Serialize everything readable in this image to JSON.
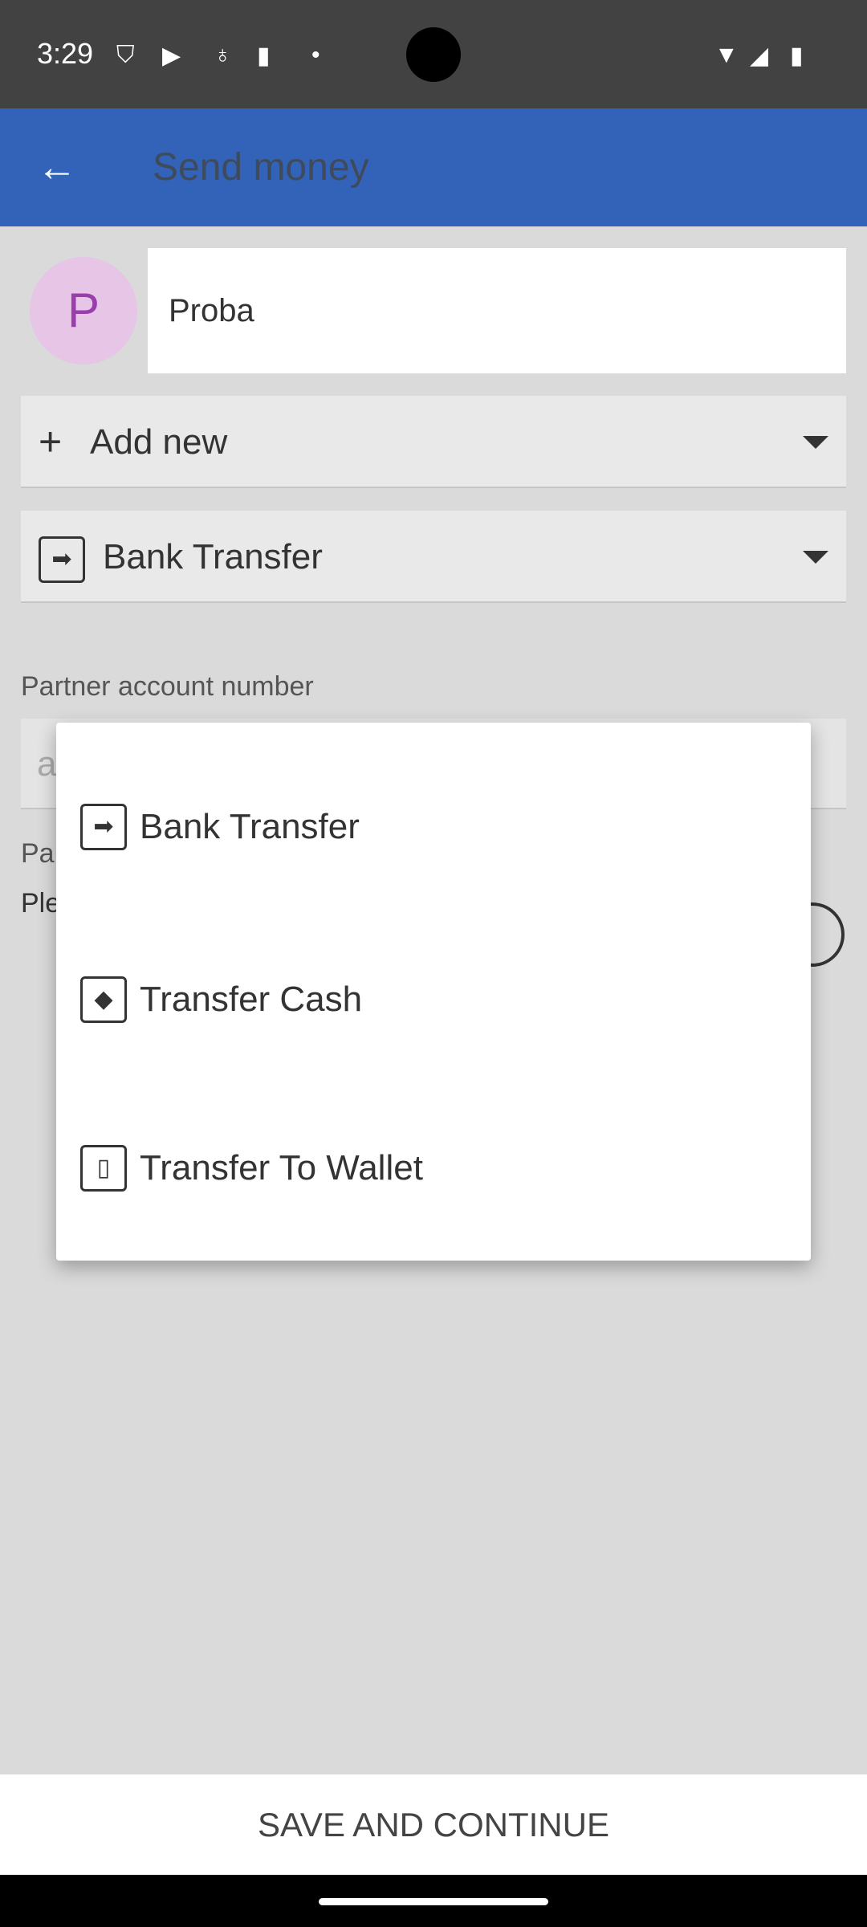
{
  "status_bar": {
    "time": "3:29",
    "icons": [
      "shield-icon",
      "play-protect-icon",
      "accessibility-icon",
      "sd-card-icon",
      "dot-icon",
      "wifi-icon",
      "signal-icon",
      "battery-icon"
    ]
  },
  "app_bar": {
    "title": "Send money",
    "back_icon": "arrow-left-icon",
    "color": "#3363b8"
  },
  "recipient": {
    "avatar_letter": "P",
    "name": "Proba"
  },
  "account_select": {
    "icon": "plus-icon",
    "value": "Add new"
  },
  "method_select": {
    "icon": "arrow-box-icon",
    "value": "Bank Transfer"
  },
  "partner_account": {
    "label": "Partner account number",
    "placeholder_fragment": "a"
  },
  "partial_labels": {
    "pa": "Pa",
    "ple": "Ple"
  },
  "dropdown_menu": {
    "items": [
      {
        "label": "Bank Transfer",
        "icon": "arrow-box-icon"
      },
      {
        "label": "Transfer Cash",
        "icon": "cash-icon"
      },
      {
        "label": "Transfer To Wallet",
        "icon": "phone-icon"
      }
    ]
  },
  "footer": {
    "save_label": "SAVE AND CONTINUE"
  }
}
